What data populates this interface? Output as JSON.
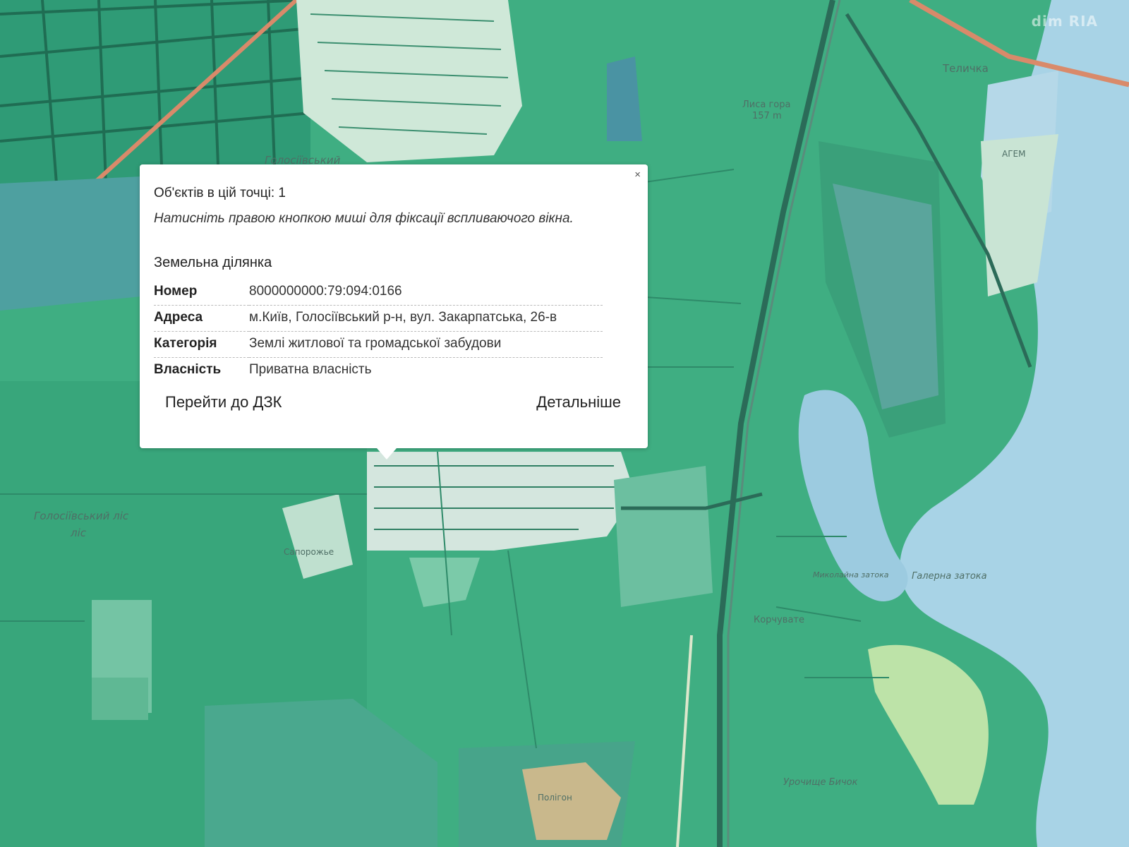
{
  "watermark": {
    "left": "dim",
    "right": "RIA"
  },
  "map": {
    "place_labels": [
      "Голосіївський",
      "Голосіївський ліс",
      "Лиса гора",
      "157 m",
      "Теличка",
      "АГЕМ",
      "Корчувате",
      "Галерна затока",
      "Миколайна затока",
      "Урочище Бичок",
      "Полігон",
      "Сапорожье"
    ]
  },
  "popup": {
    "close_label": "×",
    "count_text": "Об'єктів в цій точці: 1",
    "hint_text": "Натисніть правою кнопкою миші для фіксації вспливаючого вікна.",
    "section_title": "Земельна ділянка",
    "rows": [
      {
        "key": "Номер",
        "value": "8000000000:79:094:0166"
      },
      {
        "key": "Адреса",
        "value": "м.Київ, Голосіївський р-н, вул. Закарпатська, 26-в"
      },
      {
        "key": "Категорія",
        "value": "Землі житлової та громадської забудови"
      },
      {
        "key": "Власність",
        "value": "Приватна власність"
      }
    ],
    "button_dzk": "Перейти до ДЗК",
    "button_details": "Детальніше"
  }
}
